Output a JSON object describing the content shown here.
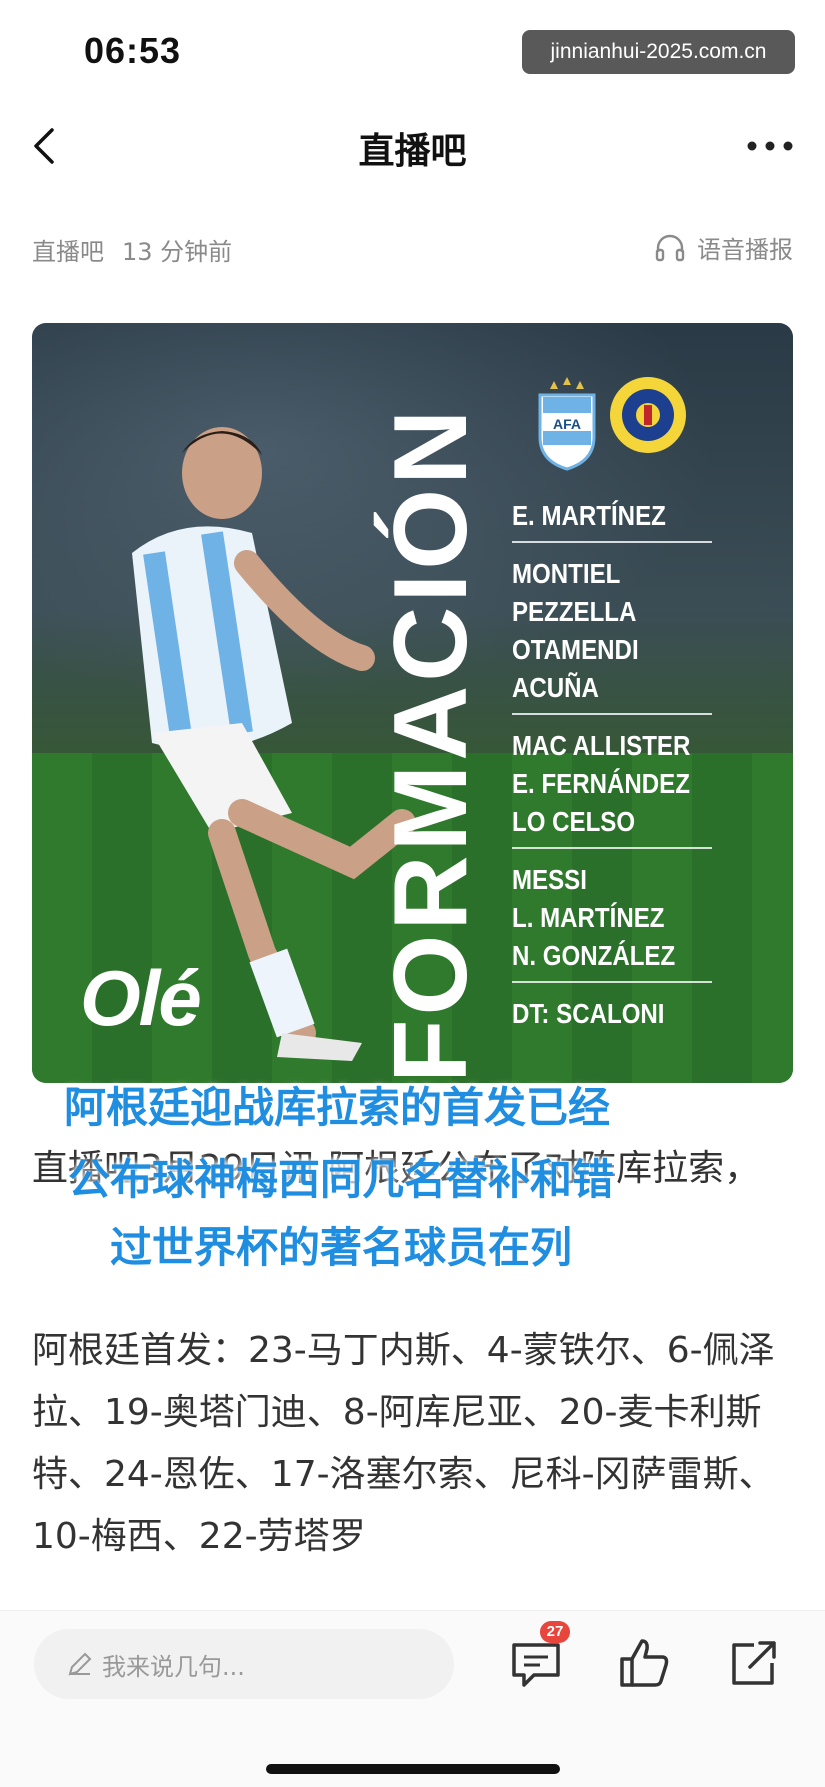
{
  "status_bar": {
    "time": "06:53",
    "watermark": "jinnianhui-2025.com.cn"
  },
  "nav": {
    "title": "直播吧",
    "back_icon": "chevron-left-icon",
    "more_icon": "more-icon"
  },
  "meta": {
    "source": "直播吧",
    "time_ago": "13 分钟前",
    "audio_label": "语音播报",
    "audio_icon": "headphones-icon"
  },
  "hero": {
    "brand": "Olé",
    "heading": "FORMACIÓN",
    "lineup_groups": [
      [
        "E. MARTÍNEZ"
      ],
      [
        "MONTIEL",
        "PEZZELLA",
        "OTAMENDI",
        "ACUÑA"
      ],
      [
        "MAC ALLISTER",
        "E. FERNÁNDEZ",
        "LO CELSO"
      ],
      [
        "MESSI",
        "L. MARTÍNEZ",
        "N. GONZÁLEZ"
      ],
      [
        "DT: SCALONI"
      ]
    ]
  },
  "overlay": {
    "line1": "阿根廷迎战库拉索的首发已经",
    "line2": "公布球神梅西同几名替补和错",
    "line3": "过世界杯的著名球员在列"
  },
  "article": {
    "paragraph1": "直播吧3月29日讯 阿根廷公布了对阵库拉索，",
    "paragraph2": "阿根廷首发：23-马丁内斯、4-蒙铁尔、6-佩泽拉、19-奥塔门迪、8-阿库尼亚、20-麦卡利斯特、24-恩佐、17-洛塞尔索、尼科-冈萨雷斯、10-梅西、22-劳塔罗"
  },
  "bottom_bar": {
    "comment_placeholder": "我来说几句...",
    "comment_count": "27",
    "icons": [
      "pencil-icon",
      "comment-icon",
      "like-icon",
      "share-icon"
    ]
  },
  "colors": {
    "overlay_text": "#1f8de0",
    "badge": "#e8453c"
  }
}
